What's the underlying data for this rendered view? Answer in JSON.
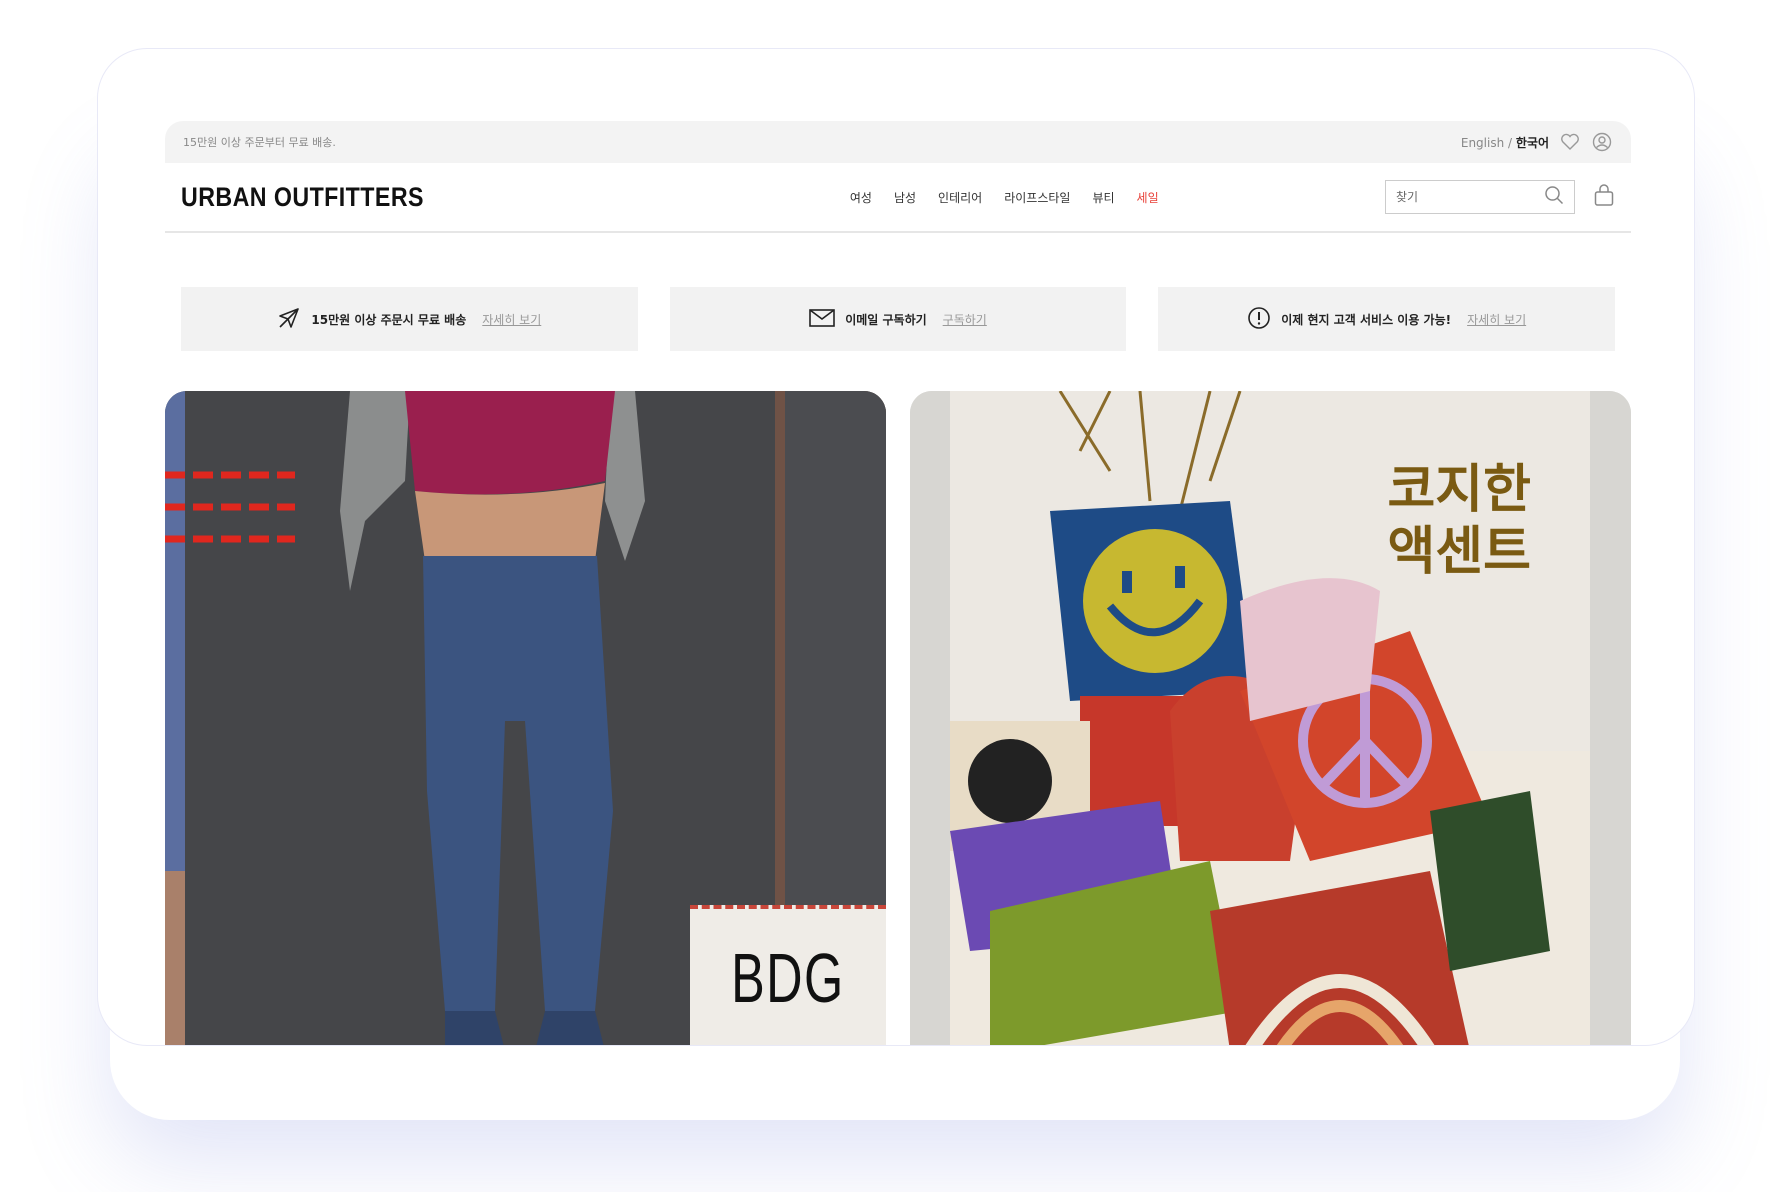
{
  "utility": {
    "promo": "15만원 이상 주문부터 무료 배송.",
    "lang_english": "English /",
    "lang_korean": "한국어"
  },
  "header": {
    "logo": "URBAN OUTFITTERS",
    "nav": [
      {
        "label": "여성"
      },
      {
        "label": "남성"
      },
      {
        "label": "인테리어"
      },
      {
        "label": "라이프스타일"
      },
      {
        "label": "뷰티"
      },
      {
        "label": "세일"
      }
    ],
    "search_placeholder": "찾기"
  },
  "infos": [
    {
      "icon": "plane-icon",
      "text": "15만원 이상 주문시 무료 배송",
      "link": "자세히 보기"
    },
    {
      "icon": "envelope-icon",
      "text": "이메일 구독하기",
      "link": "구독하기"
    },
    {
      "icon": "alert-icon",
      "text": "이제 현지 고객 서비스 이용 가능!",
      "link": "자세히 보기"
    }
  ],
  "banners": {
    "left_tag": "BDG",
    "right_title_line1": "코지한",
    "right_title_line2": "액센트"
  },
  "colors": {
    "sale": "#e8423a",
    "accent_title": "#7a5a12"
  }
}
